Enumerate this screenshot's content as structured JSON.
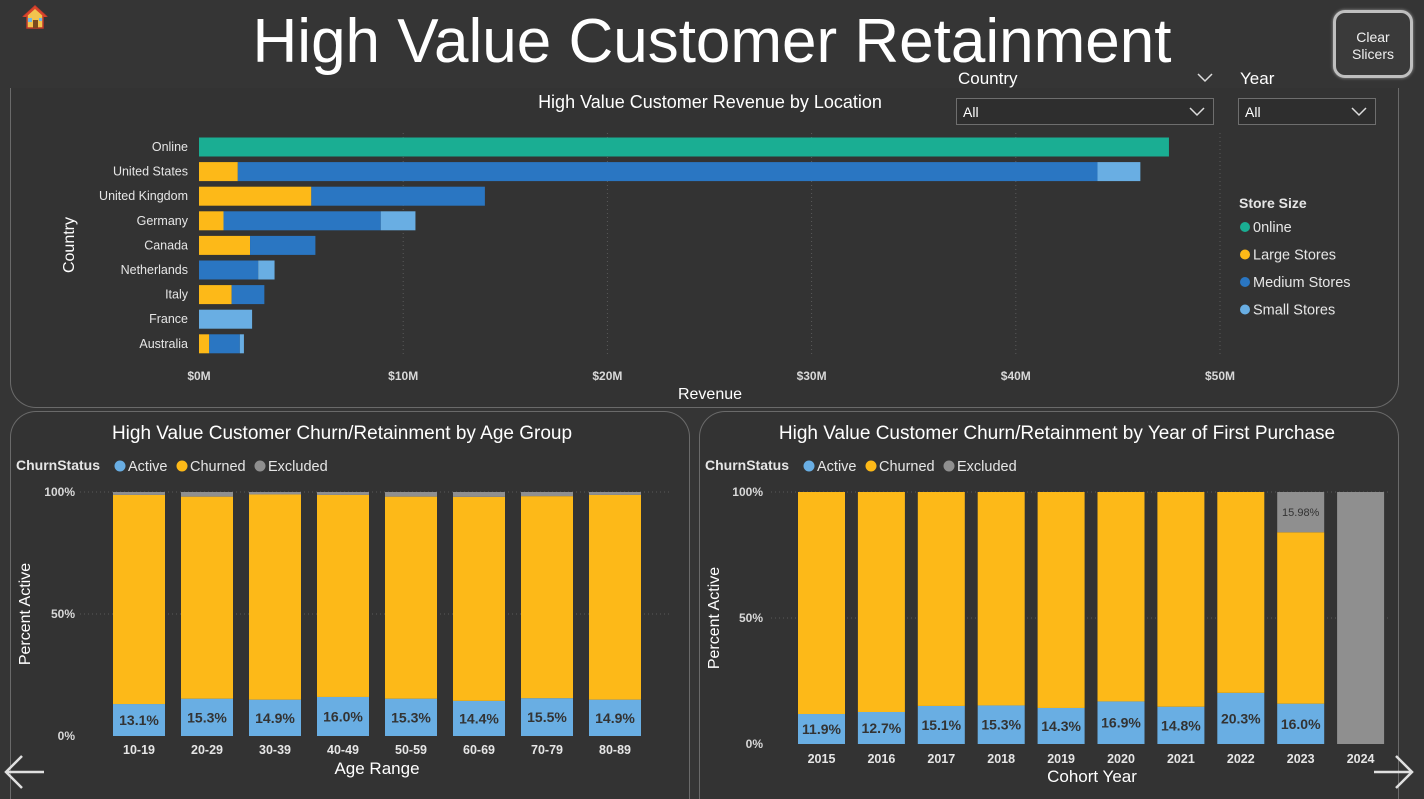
{
  "page_title": "High Value Customer Retainment",
  "clear_slicers": {
    "line1": "Clear",
    "line2": "Slicers"
  },
  "slicers": {
    "country": {
      "label": "Country",
      "value": "All"
    },
    "year": {
      "label": "Year",
      "value": "All"
    }
  },
  "colors": {
    "online": "#1aae93",
    "large": "#fdb918",
    "medium": "#2a76c2",
    "small": "#69aee3",
    "active": "#69aee3",
    "churned": "#fdb918",
    "excluded": "#8f8f8f"
  },
  "chart_data": [
    {
      "type": "bar",
      "orientation": "horizontal",
      "stacked": true,
      "title": "High Value Customer Revenue by Location",
      "xlabel": "Revenue",
      "ylabel": "Country",
      "xlim": [
        0,
        50
      ],
      "x_ticks": [
        "$0M",
        "$10M",
        "$20M",
        "$30M",
        "$40M",
        "$50M"
      ],
      "legend_title": "Store Size",
      "legend_position": "right",
      "grid": true,
      "categories": [
        "Online",
        "United States",
        "United Kingdom",
        "Germany",
        "Canada",
        "Netherlands",
        "Italy",
        "France",
        "Australia"
      ],
      "series": [
        {
          "name": "0nline",
          "values": [
            47.5,
            0,
            0,
            0,
            0,
            0,
            0,
            0,
            0
          ]
        },
        {
          "name": "Large Stores",
          "values": [
            0,
            1.9,
            5.5,
            1.2,
            2.5,
            0,
            1.6,
            0,
            0.5
          ]
        },
        {
          "name": "Medium Stores",
          "values": [
            0,
            42.1,
            8.5,
            7.7,
            3.2,
            2.9,
            1.6,
            0,
            1.5
          ]
        },
        {
          "name": "Small Stores",
          "values": [
            0,
            2.1,
            0,
            1.7,
            0,
            0.8,
            0,
            2.6,
            0.2
          ]
        }
      ]
    },
    {
      "type": "bar",
      "stacked": true,
      "percent": true,
      "title": "High Value Customer Churn/Retainment by Age Group",
      "xlabel": "Age Range",
      "ylabel": "Percent Active",
      "ylim": [
        0,
        100
      ],
      "y_ticks": [
        "0%",
        "50%",
        "100%"
      ],
      "legend_title": "ChurnStatus",
      "legend_position": "top-left",
      "grid": true,
      "categories": [
        "10-19",
        "20-29",
        "30-39",
        "40-49",
        "50-59",
        "60-69",
        "70-79",
        "80-89"
      ],
      "series": [
        {
          "name": "Active",
          "values": [
            13.1,
            15.3,
            14.9,
            16.0,
            15.3,
            14.4,
            15.5,
            14.9
          ],
          "labels": [
            "13.1%",
            "15.3%",
            "14.9%",
            "16.0%",
            "15.3%",
            "14.4%",
            "15.5%",
            "14.9%"
          ]
        },
        {
          "name": "Churned",
          "values": [
            85.7,
            82.8,
            84.1,
            82.8,
            82.8,
            83.6,
            82.8,
            83.9
          ]
        },
        {
          "name": "Excluded",
          "values": [
            1.2,
            1.9,
            1.0,
            1.2,
            1.9,
            2.0,
            1.7,
            1.2
          ]
        }
      ]
    },
    {
      "type": "bar",
      "stacked": true,
      "percent": true,
      "title": "High Value Customer Churn/Retainment by Year of First Purchase",
      "xlabel": "Cohort Year",
      "ylabel": "Percent Active",
      "ylim": [
        0,
        100
      ],
      "y_ticks": [
        "0%",
        "50%",
        "100%"
      ],
      "legend_title": "ChurnStatus",
      "legend_position": "top-left",
      "grid": true,
      "categories": [
        "2015",
        "2016",
        "2017",
        "2018",
        "2019",
        "2020",
        "2021",
        "2022",
        "2023",
        "2024"
      ],
      "series": [
        {
          "name": "Active",
          "values": [
            11.9,
            12.7,
            15.1,
            15.3,
            14.3,
            16.9,
            14.8,
            20.3,
            16.0,
            0
          ],
          "labels": [
            "11.9%",
            "12.7%",
            "15.1%",
            "15.3%",
            "14.3%",
            "16.9%",
            "14.8%",
            "20.3%",
            "16.0%",
            ""
          ]
        },
        {
          "name": "Churned",
          "values": [
            88.1,
            87.3,
            84.9,
            84.7,
            85.7,
            83.1,
            85.2,
            79.7,
            68.02,
            0
          ]
        },
        {
          "name": "Excluded",
          "values": [
            0,
            0,
            0,
            0,
            0,
            0,
            0,
            0,
            15.98,
            100
          ],
          "labels": [
            "",
            "",
            "",
            "",
            "",
            "",
            "",
            "",
            "15.98%",
            ""
          ]
        }
      ]
    }
  ]
}
